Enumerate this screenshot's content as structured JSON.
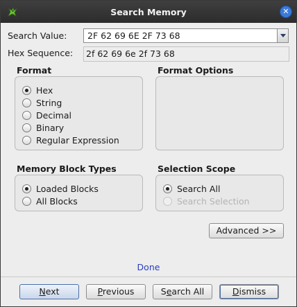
{
  "window": {
    "title": "Search Memory"
  },
  "search_value": {
    "label": "Search Value:",
    "value": "2F 62 69 6E 2F 73 68"
  },
  "hex_sequence": {
    "label": "Hex Sequence:",
    "value": "2f 62 69 6e 2f 73 68"
  },
  "format": {
    "title": "Format",
    "options": [
      "Hex",
      "String",
      "Decimal",
      "Binary",
      "Regular Expression"
    ],
    "selected": "Hex"
  },
  "format_options": {
    "title": "Format Options"
  },
  "memory_block_types": {
    "title": "Memory Block Types",
    "options": [
      "Loaded Blocks",
      "All Blocks"
    ],
    "selected": "Loaded Blocks"
  },
  "selection_scope": {
    "title": "Selection Scope",
    "options": [
      "Search All",
      "Search Selection"
    ],
    "selected": "Search All",
    "disabled": [
      "Search Selection"
    ]
  },
  "advanced_button": {
    "label": "Advanced >>"
  },
  "status": {
    "text": "Done",
    "color": "#2a3cc2"
  },
  "buttons": {
    "next": {
      "label": "Next",
      "mnemonic": "N",
      "rest": "ext"
    },
    "previous": {
      "label": "Previous",
      "mnemonic": "P",
      "rest": "revious"
    },
    "search_all": {
      "label": "Search All",
      "pre": "S",
      "mnemonic": "e",
      "rest": "arch All"
    },
    "dismiss": {
      "label": "Dismiss",
      "mnemonic": "D",
      "rest": "ismiss"
    }
  },
  "colors": {
    "accent": "#3a7ad8",
    "titlebar": "#333333"
  }
}
